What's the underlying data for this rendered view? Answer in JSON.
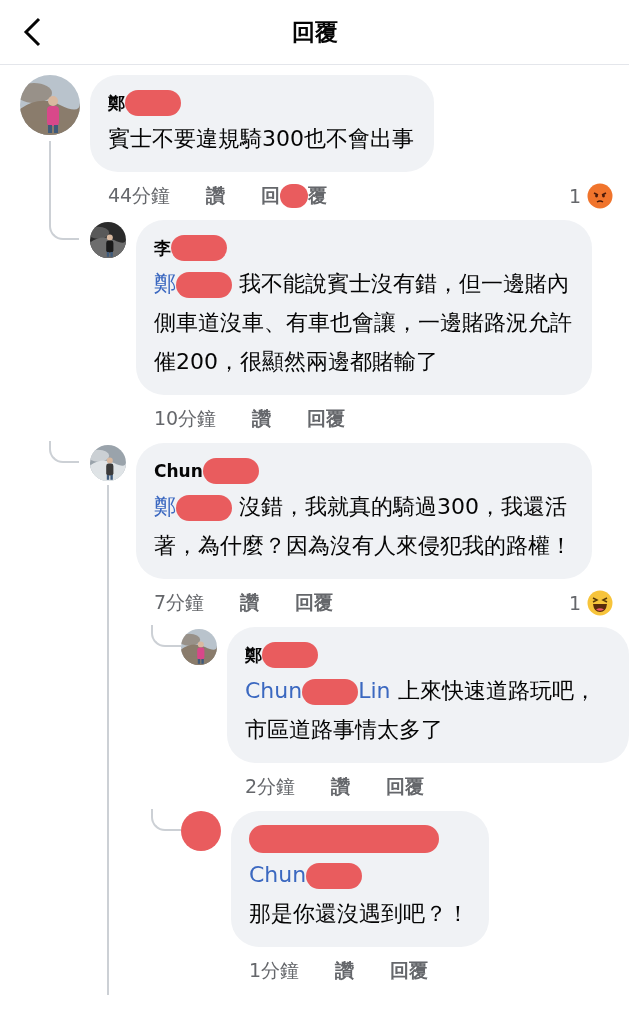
{
  "header": {
    "title": "回覆"
  },
  "comments": [
    {
      "avatar_redacted": false,
      "name": [
        {
          "kind": "text",
          "text": "鄭"
        },
        {
          "kind": "redaction"
        }
      ],
      "body": [
        {
          "kind": "text",
          "text": "賓士不要違規騎300也不會出事"
        }
      ],
      "time": "44分鐘",
      "like": "讚",
      "reply": [
        {
          "kind": "text",
          "text": "回"
        },
        {
          "kind": "redaction"
        },
        {
          "kind": "text",
          "text": "覆"
        }
      ],
      "reaction": {
        "count": "1",
        "kind": "angry"
      },
      "children": [
        {
          "avatar_redacted": false,
          "name": [
            {
              "kind": "text",
              "text": "李"
            },
            {
              "kind": "redaction"
            }
          ],
          "body": [
            {
              "kind": "mention",
              "text": "鄭"
            },
            {
              "kind": "redaction"
            },
            {
              "kind": "text",
              "text": " 我不能說賓士沒有錯，但一邊賭內側車道沒車、有車也會讓，一邊賭路況允許催200，很顯然兩邊都賭輸了"
            }
          ],
          "time": "10分鐘",
          "like": "讚",
          "reply": [
            {
              "kind": "text",
              "text": "回覆"
            }
          ]
        },
        {
          "avatar_redacted": false,
          "name": [
            {
              "kind": "text",
              "text": "Chun"
            },
            {
              "kind": "redaction"
            }
          ],
          "body": [
            {
              "kind": "mention",
              "text": "鄭"
            },
            {
              "kind": "redaction"
            },
            {
              "kind": "text",
              "text": " 沒錯，我就真的騎過300，我還活著，為什麼？因為沒有人來侵犯我的路權！"
            }
          ],
          "time": "7分鐘",
          "like": "讚",
          "reply": [
            {
              "kind": "text",
              "text": "回覆"
            }
          ],
          "reaction": {
            "count": "1",
            "kind": "haha"
          },
          "children": [
            {
              "avatar_redacted": false,
              "name": [
                {
                  "kind": "text",
                  "text": "鄭"
                },
                {
                  "kind": "redaction"
                }
              ],
              "body": [
                {
                  "kind": "mention",
                  "text": "Chun"
                },
                {
                  "kind": "redaction"
                },
                {
                  "kind": "mention",
                  "text": "Lin"
                },
                {
                  "kind": "text",
                  "text": " 上來快速道路玩吧，市區道路事情太多了"
                }
              ],
              "time": "2分鐘",
              "like": "讚",
              "reply": [
                {
                  "kind": "text",
                  "text": "回覆"
                }
              ]
            },
            {
              "avatar_redacted": true,
              "name": [
                {
                  "kind": "strike"
                }
              ],
              "body": [
                {
                  "kind": "mention",
                  "text": "Chun"
                },
                {
                  "kind": "redaction"
                },
                {
                  "kind": "break"
                },
                {
                  "kind": "text",
                  "text": "那是你還沒遇到吧？！"
                }
              ],
              "time": "1分鐘",
              "like": "讚",
              "reply": [
                {
                  "kind": "text",
                  "text": "回覆"
                }
              ]
            }
          ]
        }
      ]
    }
  ]
}
